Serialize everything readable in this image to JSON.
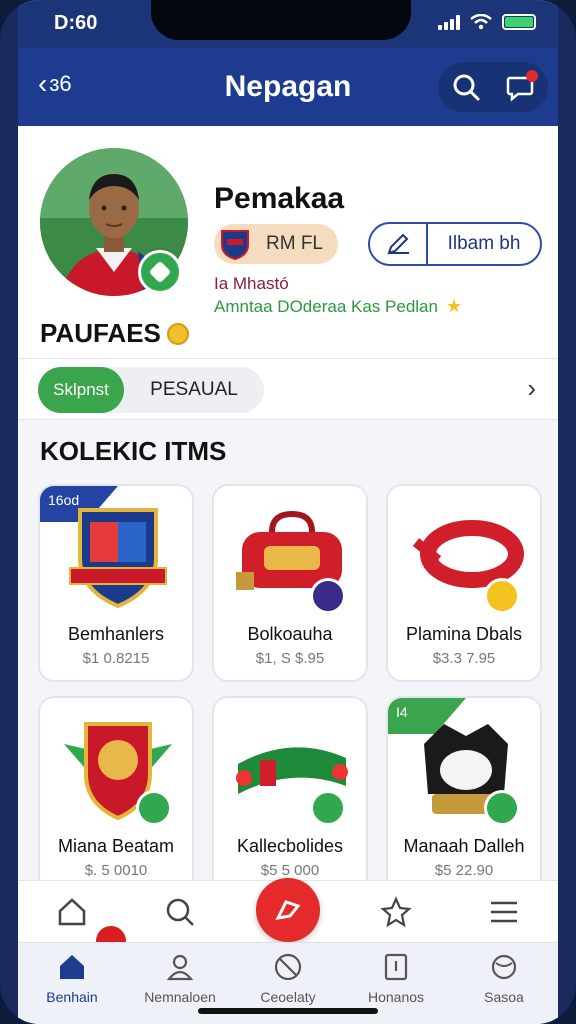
{
  "status_bar": {
    "time": "D:60"
  },
  "header": {
    "back_label": "ɜ6",
    "title": "Nepagan"
  },
  "profile": {
    "name": "Pemakaa",
    "club_label": "RM FL",
    "edit_label": "Ilbam bh",
    "sub_line1": "Ia Mhastó",
    "sub_line2": "Amntaa DOderaa Kas Pedlan"
  },
  "sections": {
    "paufaes": "PAUFAES",
    "collection": "KOLEKIC ITMS"
  },
  "toggle": {
    "active_label": "Sklpnst",
    "inactive_label": "PESAUAL"
  },
  "items": [
    {
      "name": "Bemhanlers",
      "price": "$1 0.8215",
      "tag": "16od",
      "tag_color": "#2344a3",
      "badge_color": null
    },
    {
      "name": "Bolkoauha",
      "price": "$1, S $.95",
      "tag": null,
      "tag_color": null,
      "badge_color": "#3a2a8c"
    },
    {
      "name": "Plamina Dbals",
      "price": "$3.3 7.95",
      "tag": null,
      "tag_color": null,
      "badge_color": "#f2c320"
    },
    {
      "name": "Miana Beatam",
      "price": "$. 5 0010",
      "tag": null,
      "tag_color": null,
      "badge_color": "#2fa84f"
    },
    {
      "name": "Kallecbolides",
      "price": "$5 5 000",
      "tag": null,
      "tag_color": null,
      "badge_color": "#2fa84f"
    },
    {
      "name": "Manaah Dalleh",
      "price": "$5 22.90",
      "tag": "I4",
      "tag_color": "#3aa54d",
      "badge_color": "#2fa84f"
    }
  ],
  "tabs": [
    {
      "label": "Benhain",
      "icon": "home-icon",
      "active": true
    },
    {
      "label": "Nemnaloen",
      "icon": "user-icon",
      "active": false
    },
    {
      "label": "Ceoelaty",
      "icon": "block-icon",
      "active": false
    },
    {
      "label": "Honanos",
      "icon": "document-icon",
      "active": false
    },
    {
      "label": "Sasoa",
      "icon": "ball-icon",
      "active": false
    }
  ],
  "colors": {
    "primary": "#1d3c8f",
    "accent_green": "#3aa54d",
    "accent_red": "#e42a2a"
  }
}
